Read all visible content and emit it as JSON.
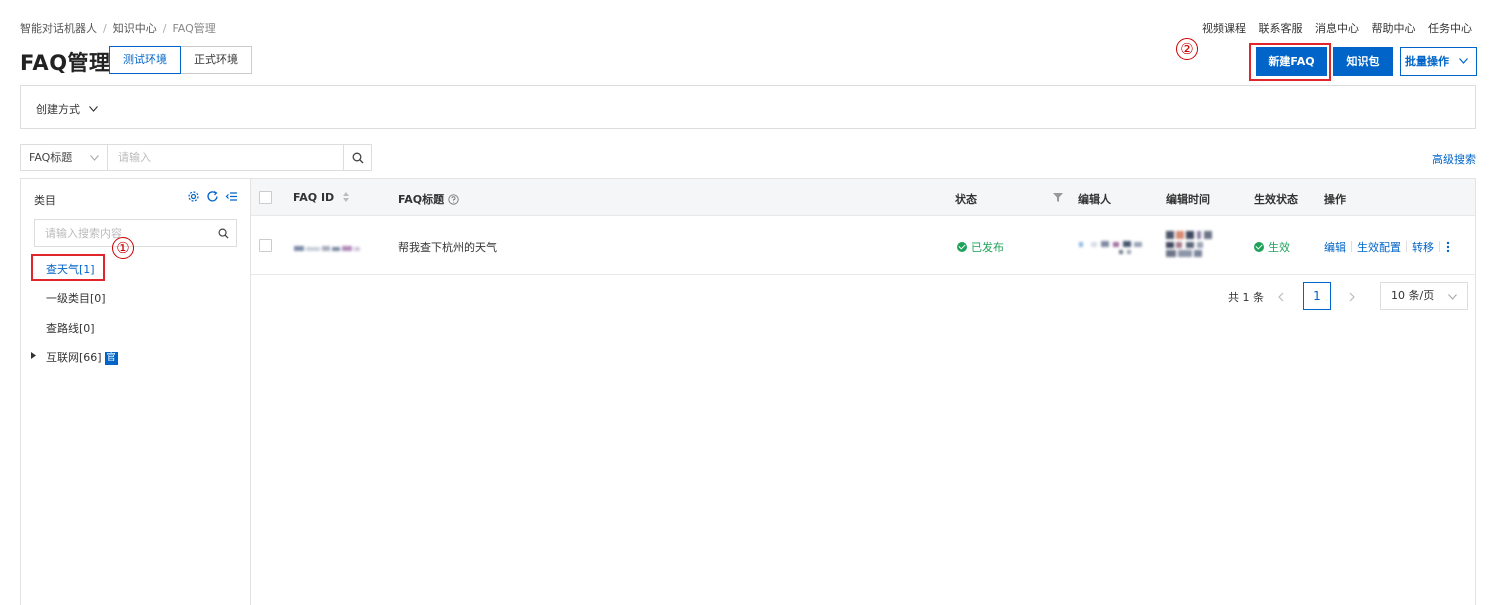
{
  "breadcrumb": [
    "智能对话机器人",
    "知识中心",
    "FAQ管理"
  ],
  "top_links": [
    "视频课程",
    "联系客服",
    "消息中心",
    "帮助中心",
    "任务中心"
  ],
  "page_title": "FAQ管理",
  "env_tabs": [
    {
      "label": "测试环境",
      "active": true
    },
    {
      "label": "正式环境",
      "active": false
    }
  ],
  "annotations": {
    "one": "①",
    "two": "②"
  },
  "actions": {
    "new_faq": "新建FAQ",
    "knowledge_pack": "知识包",
    "batch": "批量操作"
  },
  "filter": {
    "create_method": "创建方式"
  },
  "search": {
    "field": "FAQ标题",
    "placeholder": "请输入",
    "advanced": "高级搜索"
  },
  "sidebar": {
    "title": "类目",
    "search_placeholder": "请输入搜索内容",
    "items": [
      {
        "label": "查天气[1]",
        "selected": true
      },
      {
        "label": "一级类目[0]",
        "selected": false
      },
      {
        "label": "查路线[0]",
        "selected": false
      },
      {
        "label": "互联网[66]",
        "selected": false,
        "badge": "官",
        "expandable": true
      }
    ]
  },
  "table": {
    "columns": [
      "FAQ ID",
      "FAQ标题",
      "状态",
      "编辑人",
      "编辑时间",
      "生效状态",
      "操作"
    ],
    "rows": [
      {
        "title": "帮我查下杭州的天气",
        "status": "已发布",
        "effect_status": "生效",
        "ops": [
          "编辑",
          "生效配置",
          "转移"
        ]
      }
    ]
  },
  "pagination": {
    "total": "共 1 条",
    "current": "1",
    "page_size": "10 条/页"
  },
  "colors": {
    "primary": "#0064c8",
    "success": "#1ea25a",
    "annotation_red": "#e0252b"
  }
}
